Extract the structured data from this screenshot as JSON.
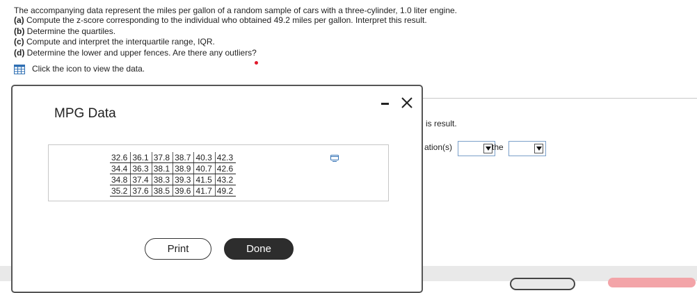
{
  "question": {
    "intro": "The accompanying data represent the miles per gallon of a random sample of cars with a three-cylinder, 1.0 liter engine.",
    "parts": [
      {
        "label": "(a)",
        "text": "Compute the z-score corresponding to the individual who obtained 49.2 miles per gallon. Interpret this result."
      },
      {
        "label": "(b)",
        "text": "Determine the quartiles."
      },
      {
        "label": "(c)",
        "text": "Compute and interpret the interquartile range, IQR."
      },
      {
        "label": "(d)",
        "text": "Determine the lower and upper fences. Are there any outliers?"
      }
    ],
    "data_link": "Click the icon to view the data."
  },
  "background": {
    "result_fragment": "is result.",
    "answer_fragment": "ation(s)",
    "the_word": "the"
  },
  "modal": {
    "title": "MPG Data",
    "table": [
      [
        "32.6",
        "36.1",
        "37.8",
        "38.7",
        "40.3",
        "42.3"
      ],
      [
        "34.4",
        "36.3",
        "38.1",
        "38.9",
        "40.7",
        "42.6"
      ],
      [
        "34.8",
        "37.4",
        "38.3",
        "39.3",
        "41.5",
        "43.2"
      ],
      [
        "35.2",
        "37.6",
        "38.5",
        "39.6",
        "41.7",
        "49.2"
      ]
    ],
    "print_label": "Print",
    "done_label": "Done"
  },
  "colors": {
    "accent_red": "#e0182b",
    "done_button": "#2d2d2d",
    "select_border": "#7a9fc9"
  },
  "icons": [
    "grid-icon",
    "minimize-icon",
    "close-icon",
    "copy-icon"
  ]
}
